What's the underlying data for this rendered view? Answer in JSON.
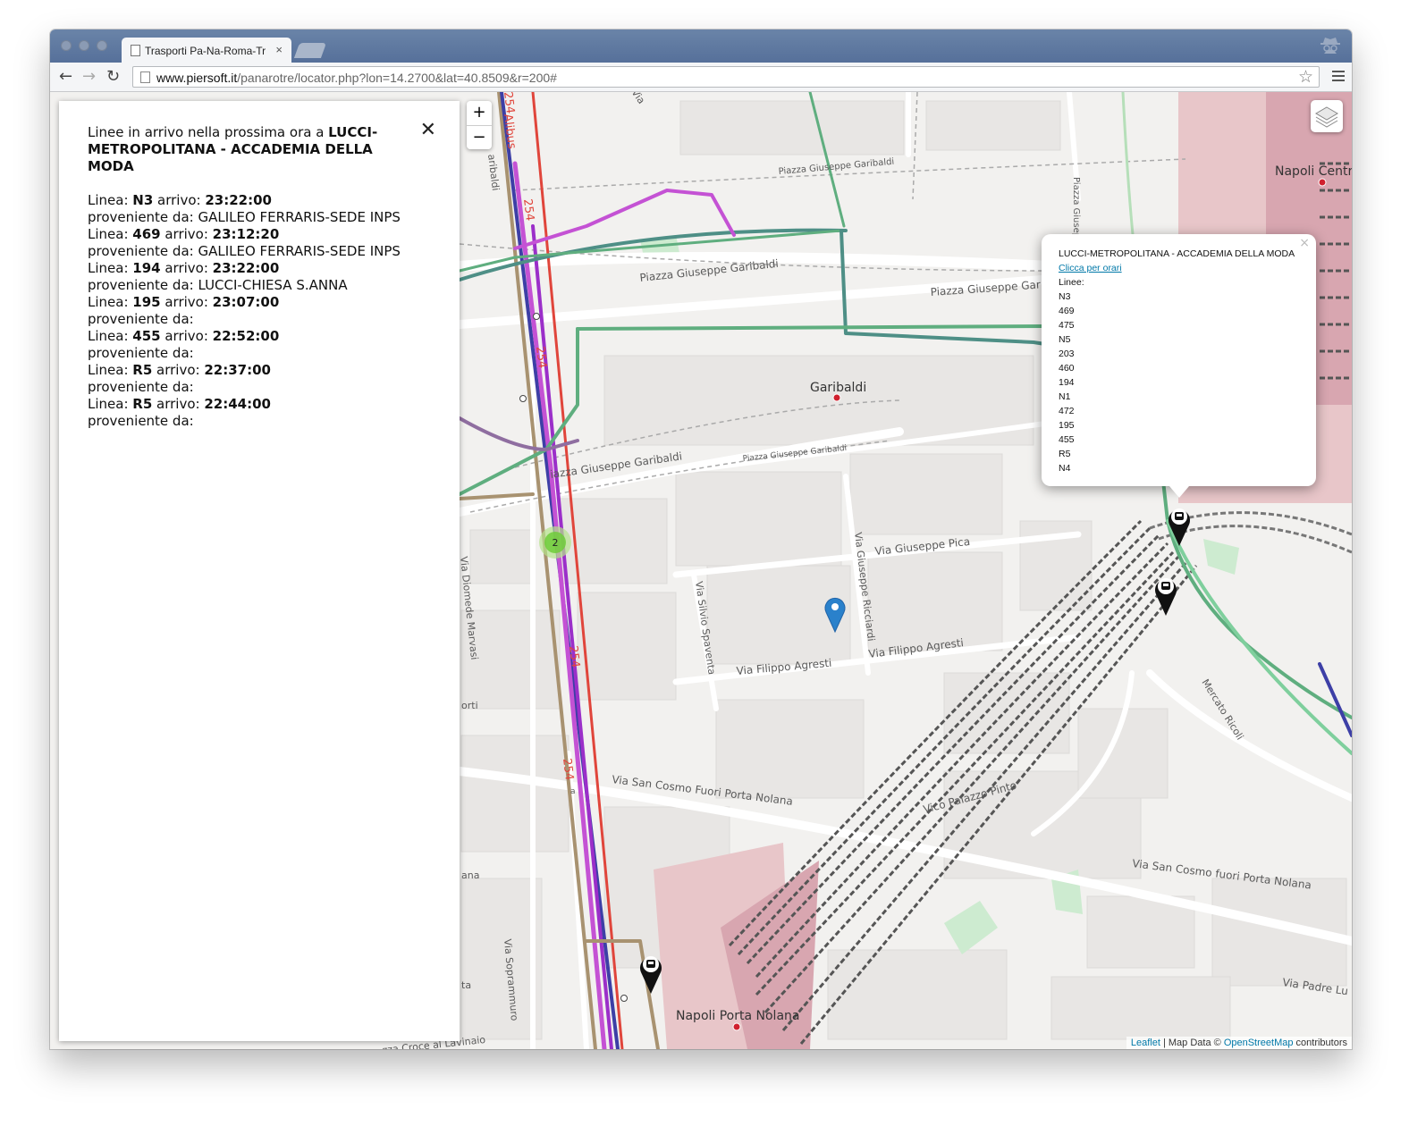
{
  "browser": {
    "tab_title": "Trasporti Pa-Na-Roma-Tr",
    "tab_close": "×",
    "url_host": "www.piersoft.it",
    "url_path": "/panarotre/locator.php?lon=14.2700&lat=40.8509&r=200#"
  },
  "sidebar": {
    "intro": "Linee in arrivo nella prossima ora a ",
    "stop_name": "LUCCI-METROPOLITANA - ACCADEMIA DELLA MODA",
    "close": "✕",
    "line_label": "Linea: ",
    "arrival_label": " arrivo: ",
    "origin_label": "proveniente da: ",
    "arrivals": [
      {
        "line": "N3",
        "time": "23:22:00",
        "origin": "GALILEO FERRARIS-SEDE INPS"
      },
      {
        "line": "469",
        "time": "23:12:20",
        "origin": "GALILEO FERRARIS-SEDE INPS"
      },
      {
        "line": "194",
        "time": "23:22:00",
        "origin": "LUCCI-CHIESA S.ANNA"
      },
      {
        "line": "195",
        "time": "23:07:00",
        "origin": ""
      },
      {
        "line": "455",
        "time": "22:52:00",
        "origin": ""
      },
      {
        "line": "R5",
        "time": "22:37:00",
        "origin": ""
      },
      {
        "line": "R5",
        "time": "22:44:00",
        "origin": ""
      }
    ]
  },
  "map": {
    "zoom_in": "+",
    "zoom_out": "−",
    "cluster_count": "2",
    "labels": {
      "napoli_centrale": "Napoli Centr",
      "garibaldi": "Garibaldi",
      "napoli_porta_nolana": "Napoli Porta Nolana",
      "piazza_garibaldi_1": "Piazza Giuseppe Garibaldi",
      "piazza_garibaldi_2": "Piazza Giuseppe Garibaldi",
      "piazza_garibaldi_3": "Piazza Giuseppe Gar",
      "piazza_garibaldi_4": "iazza Giuseppe Garibaldi",
      "piazza_garibaldi_5": "Piazza Giuseppe Garibaldi",
      "piazza_garibaldi_6": "Piazza Giuseppe Garibaldi",
      "piazza_giuseppe_vert": "Piazza Giuseppe",
      "via_giuseppe_pica": "Via Giuseppe Pica",
      "via_silvio_spaventa": "Via Silvio Spaventa",
      "via_giuseppe_ricciardi": "Via Giuseppe Ricciardi",
      "via_filippo_agresti_1": "Via Filippo Agresti",
      "via_filippo_agresti_2": "Via Filippo Agresti",
      "via_diomede_marvasi": "Via Diomede Marvasi",
      "via_san_cosmo_1": "Via San Cosmo Fuori Porta Nolana",
      "via_san_cosmo_2": "Via San Cosmo fuori Porta Nolana",
      "vico_palazzo_pinto": "Vico Palazzo Pinto",
      "mercato_ricoli": "Mercato Ricoli",
      "via_padre_lu": "Via Padre Lu",
      "via_soprammuro": "Via Soprammuro",
      "piazza_croce": "zza Croce al Lavinaio",
      "route_254_a": "254",
      "route_254_b": "254",
      "route_254_c": "254",
      "route_254_d": "254",
      "route_254_e": "254",
      "route_a": "a",
      "alibus": "Alibus",
      "aribaldi": "aribaldi",
      "via_cut": "Via",
      "orti": "orti",
      "ana": "ana",
      "ta": "ta"
    },
    "popup": {
      "title": "LUCCI-METROPOLITANA - ACCADEMIA DELLA MODA",
      "link": "Clicca per orari",
      "lines_label": "Linee:",
      "lines": [
        "N3",
        "469",
        "475",
        "N5",
        "203",
        "460",
        "194",
        "N1",
        "472",
        "195",
        "455",
        "R5",
        "N4"
      ],
      "close": "×"
    },
    "attribution": {
      "leaflet": "Leaflet",
      "sep": " | Map Data © ",
      "osm": "OpenStreetMap",
      "suffix": " contributors"
    },
    "colors": {
      "route_purple": "#9b2fc9",
      "route_magenta": "#c452d4",
      "route_green": "#5fae7f",
      "route_teal": "#4e8f86",
      "route_red": "#e0453b",
      "route_navy": "#3d3fa6",
      "route_tan": "#a89270",
      "station_pink": "#e8c6c9",
      "marker_blue": "#2a81cb"
    }
  }
}
